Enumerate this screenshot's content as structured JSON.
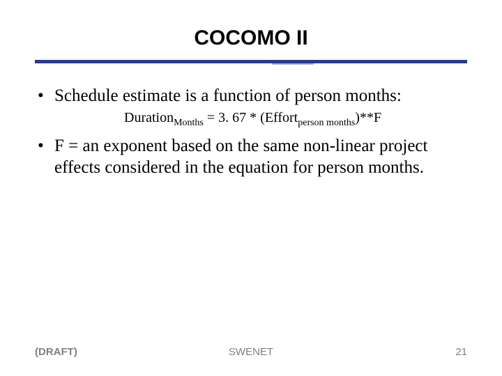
{
  "title": "COCOMO II",
  "bullets": {
    "b1": "Schedule estimate is a function of person months:",
    "b2": "F = an exponent based on the same non-linear project effects considered in the equation for person months."
  },
  "formula": {
    "lhs_base": "Duration",
    "lhs_sub": "Months",
    "eq_const": " = 3. 67 * (Effort",
    "rhs_sub": "person months",
    "tail": ")**F"
  },
  "footer": {
    "left": "(DRAFT)",
    "center": "SWENET",
    "right": "21"
  }
}
